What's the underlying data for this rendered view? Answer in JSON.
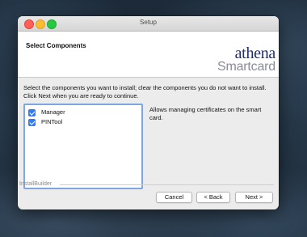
{
  "window": {
    "title": "Setup"
  },
  "header": {
    "title": "Select Components",
    "logo_line1": "athena",
    "logo_line2": "Smartcard"
  },
  "main": {
    "instructions": "Select the components you want to install; clear the components you do not want to install. Click Next when you are ready to continue.",
    "components": [
      {
        "label": "Manager",
        "checked": true
      },
      {
        "label": "PINTool",
        "checked": true
      }
    ],
    "description": "Allows managing certificates on the smart card."
  },
  "footer": {
    "brand": "InstallBuilder",
    "cancel_label": "Cancel",
    "back_label": "< Back",
    "next_label": "Next >"
  },
  "colors": {
    "accent": "#2f7cf6",
    "logo_primary": "#1f2d6e",
    "logo_secondary": "#8a8a9a"
  }
}
